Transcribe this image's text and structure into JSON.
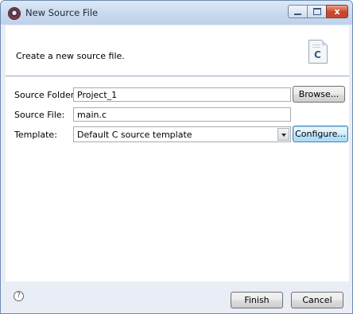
{
  "window": {
    "title": "New Source File",
    "controls": {
      "minimize": "minimize",
      "maximize": "maximize",
      "close": "x"
    }
  },
  "banner": {
    "description": "Create a new source file.",
    "icon": "c-source-file-icon",
    "icon_letter": "C"
  },
  "form": {
    "source_folder": {
      "label": "Source Folder:",
      "value": "Project_1",
      "button": "Browse..."
    },
    "source_file": {
      "label": "Source File:",
      "value": "main.c"
    },
    "template": {
      "label": "Template:",
      "selected": "Default C source template",
      "button": "Configure..."
    }
  },
  "footer": {
    "help_glyph": "?",
    "finish": "Finish",
    "cancel": "Cancel"
  }
}
